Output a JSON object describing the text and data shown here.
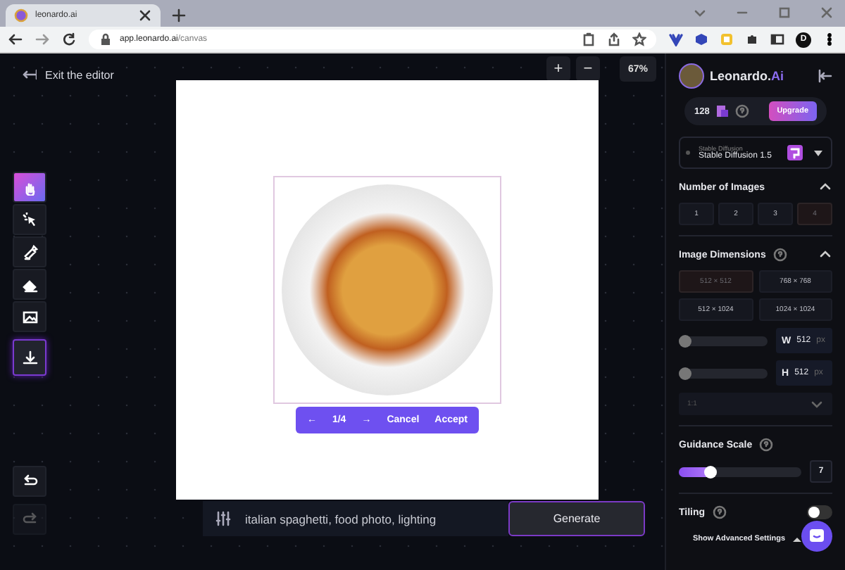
{
  "browser": {
    "tab_title": "leonardo.ai",
    "url_host": "app.leonardo.ai",
    "url_path": "/canvas",
    "profile": "D"
  },
  "editor": {
    "exit_label": "Exit the editor",
    "tools": [
      {
        "kind": "hand",
        "selected": true,
        "highlighted": false
      },
      {
        "kind": "select",
        "selected": false,
        "highlighted": false
      },
      {
        "kind": "brush",
        "selected": false,
        "highlighted": false
      },
      {
        "kind": "eraser",
        "selected": false,
        "highlighted": false
      },
      {
        "kind": "image",
        "selected": false,
        "highlighted": false
      },
      {
        "kind": "download",
        "selected": false,
        "highlighted": true
      }
    ],
    "history": [
      {
        "kind": "undo",
        "disabled": false
      },
      {
        "kind": "redo",
        "disabled": true
      }
    ],
    "zoom": {
      "plus": "+",
      "minus": "−",
      "level": "67%"
    },
    "pager": {
      "prev": "←",
      "count": "1/4",
      "next": "→",
      "cancel": "Cancel",
      "accept": "Accept"
    },
    "prompt": {
      "value": "italian spaghetti, food photo, lighting",
      "generate": "Generate"
    }
  },
  "panel": {
    "brand": "Leonardo.",
    "brand_accent": "Ai",
    "credits": "128",
    "upgrade": "Upgrade",
    "model": {
      "caption": "Stable Diffusion",
      "name": "Stable Diffusion 1.5"
    },
    "number_of_images": {
      "title": "Number of Images",
      "expanded": true,
      "options": [
        {
          "label": "1",
          "selected": false
        },
        {
          "label": "2",
          "selected": false
        },
        {
          "label": "3",
          "selected": false
        },
        {
          "label": "4",
          "selected": true
        }
      ]
    },
    "image_dimensions": {
      "title": "Image Dimensions",
      "expanded": true,
      "options": [
        {
          "label": "512 × 512",
          "selected": true
        },
        {
          "label": "768 × 768",
          "selected": false
        },
        {
          "label": "512 × 1024",
          "selected": false
        },
        {
          "label": "1024 × 1024",
          "selected": false
        }
      ],
      "sliders": [
        {
          "axis": "W",
          "value": "512",
          "unit": "px",
          "level": 0
        },
        {
          "axis": "H",
          "value": "512",
          "unit": "px",
          "level": 0
        }
      ],
      "ratio": {
        "value": "1:1",
        "disabled": true
      }
    },
    "guidance": {
      "title": "Guidance Scale",
      "level": 0.27,
      "value": "7"
    },
    "tiling": {
      "title": "Tiling",
      "on": false
    },
    "advanced": "Show Advanced Settings"
  }
}
